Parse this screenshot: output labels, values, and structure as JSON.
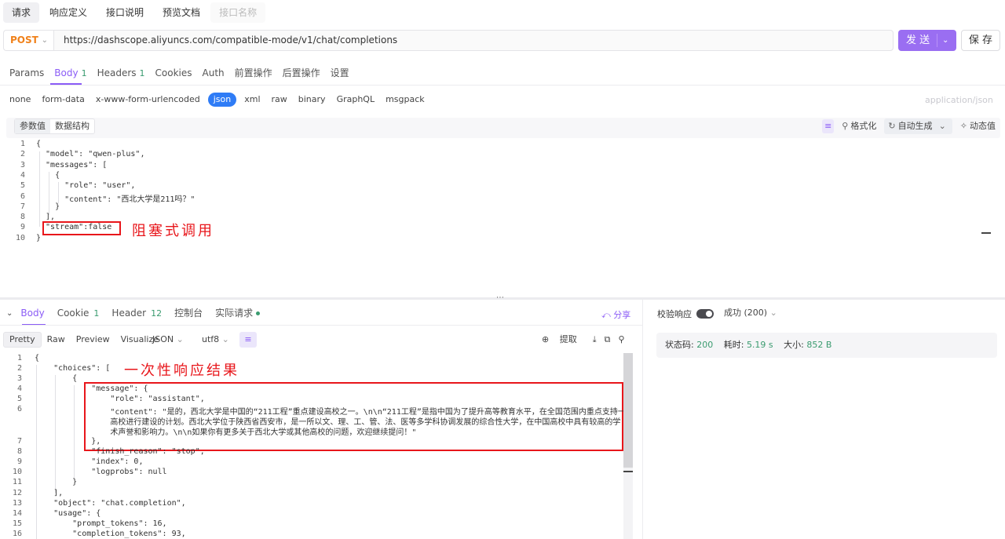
{
  "top_tabs": [
    {
      "label": "请求",
      "active": true
    },
    {
      "label": "响应定义",
      "active": false
    },
    {
      "label": "接口说明",
      "active": false
    },
    {
      "label": "预览文档",
      "active": false
    },
    {
      "label": "接口名称",
      "active": false
    }
  ],
  "request": {
    "method": "POST",
    "url": "https://dashscope.aliyuncs.com/compatible-mode/v1/chat/completions",
    "send_label": "发 送",
    "save_label": "保 存"
  },
  "request_tabs": [
    {
      "label": "Params",
      "count": ""
    },
    {
      "label": "Body",
      "count": "1"
    },
    {
      "label": "Headers",
      "count": "1"
    },
    {
      "label": "Cookies",
      "count": ""
    },
    {
      "label": "Auth",
      "count": ""
    },
    {
      "label": "前置操作",
      "count": ""
    },
    {
      "label": "后置操作",
      "count": ""
    },
    {
      "label": "设置",
      "count": ""
    }
  ],
  "body_formats": [
    "none",
    "form-data",
    "x-www-form-urlencoded",
    "json",
    "xml",
    "raw",
    "binary",
    "GraphQL",
    "msgpack"
  ],
  "content_type": "application/json",
  "editor_modes": [
    "参数值",
    "数据结构"
  ],
  "editor_tools": {
    "format": "格式化",
    "auto_generate": "自动生成",
    "dynamic": "动态值"
  },
  "request_code": [
    {
      "n": "1",
      "text": "{"
    },
    {
      "n": "2",
      "text": "  \"model\": \"qwen-plus\","
    },
    {
      "n": "3",
      "text": "  \"messages\": ["
    },
    {
      "n": "4",
      "text": "    {"
    },
    {
      "n": "5",
      "text": "      \"role\": \"user\","
    },
    {
      "n": "6",
      "text": "      \"content\": \"西北大学是211吗？\""
    },
    {
      "n": "7",
      "text": "    }"
    },
    {
      "n": "8",
      "text": "  ],"
    },
    {
      "n": "9",
      "text": "  \"stream\":false"
    },
    {
      "n": "10",
      "text": "}"
    }
  ],
  "annotations": {
    "blocking": "阻塞式调用",
    "one_shot": "一次性响应结果"
  },
  "response_tabs": [
    {
      "label": "Body",
      "count": ""
    },
    {
      "label": "Cookie",
      "count": "1"
    },
    {
      "label": "Header",
      "count": "12"
    },
    {
      "label": "控制台",
      "count": ""
    },
    {
      "label": "实际请求",
      "count": ""
    }
  ],
  "share_label": "分享",
  "view_modes": [
    "Pretty",
    "Raw",
    "Preview",
    "Visualize"
  ],
  "json_select": "JSON",
  "encoding_select": "utf8",
  "extract_label": "提取",
  "response_code": [
    {
      "n": "1",
      "text": "{"
    },
    {
      "n": "2",
      "text": "    \"choices\": ["
    },
    {
      "n": "3",
      "text": "        {"
    },
    {
      "n": "4",
      "text": "            \"message\": {"
    },
    {
      "n": "5",
      "text": "                \"role\": \"assistant\","
    },
    {
      "n": "6",
      "text": "                \"content\": \"是的，西北大学是中国的“211工程”重点建设高校之一。\\n\\n“211工程”是指中国为了提升高等教育水平，在全国范围内重点支持一批"
    },
    {
      "n": "",
      "text": "                高校进行建设的计划。西北大学位于陕西省西安市，是一所以文、理、工、管、法、医等多学科协调发展的综合性大学，在中国高校中具有较高的学"
    },
    {
      "n": "",
      "text": "                术声誉和影响力。\\n\\n如果你有更多关于西北大学或其他高校的问题，欢迎继续提问！\""
    },
    {
      "n": "7",
      "text": "            },"
    },
    {
      "n": "8",
      "text": "            \"finish_reason\": \"stop\","
    },
    {
      "n": "9",
      "text": "            \"index\": 0,"
    },
    {
      "n": "10",
      "text": "            \"logprobs\": null"
    },
    {
      "n": "11",
      "text": "        }"
    },
    {
      "n": "12",
      "text": "    ],"
    },
    {
      "n": "13",
      "text": "    \"object\": \"chat.completion\","
    },
    {
      "n": "14",
      "text": "    \"usage\": {"
    },
    {
      "n": "15",
      "text": "        \"prompt_tokens\": 16,"
    },
    {
      "n": "16",
      "text": "        \"completion_tokens\": 93,"
    }
  ],
  "validate_label": "校验响应",
  "success_select": "成功 (200)",
  "stats": {
    "status_label": "状态码:",
    "status_value": "200",
    "time_label": "耗时:",
    "time_value": "5.19 s",
    "size_label": "大小:",
    "size_value": "852 B"
  },
  "colors": {
    "accent": "#8b5cf6",
    "method": "#f0811a",
    "json_active": "#2f7cf6",
    "annotation": "#e8161b",
    "success": "#3a9b6f"
  }
}
